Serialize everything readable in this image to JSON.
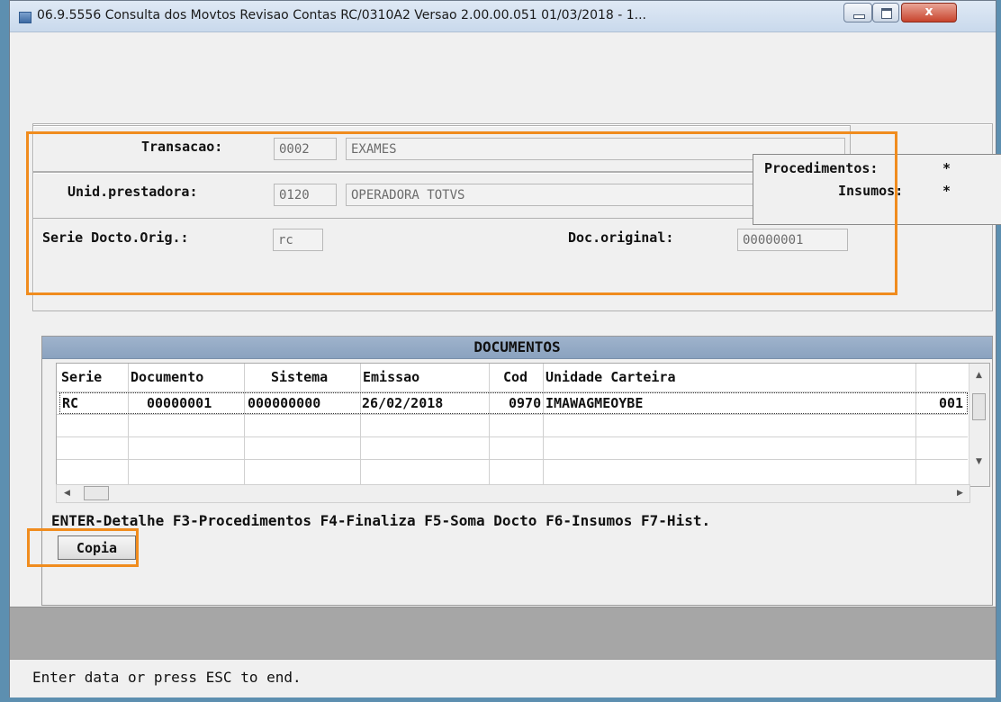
{
  "window": {
    "title": "06.9.5556 Consulta  dos Movtos Revisao Contas RC/0310A2 Versao 2.00.00.051 01/03/2018 - 1...",
    "close_glyph": "x"
  },
  "form": {
    "transacao_label": "Transacao:",
    "transacao_code": "0002",
    "transacao_desc": "EXAMES",
    "unid_label": "Unid.prestadora:",
    "unid_code": "0120",
    "unid_desc": "OPERADORA TOTVS",
    "serie_label": "Serie Docto.Orig.:",
    "serie_value": "rc",
    "doc_label": "Doc.original:",
    "doc_value": "00000001",
    "procedimentos_label": "Procedimentos:",
    "procedimentos_value": "*",
    "insumos_label": "Insumos:",
    "insumos_value": "*"
  },
  "documents": {
    "header": "DOCUMENTOS",
    "columns": [
      "Serie",
      "Documento",
      "Sistema",
      "Emissao",
      "Cod",
      "Unidade Carteira"
    ],
    "rows": [
      {
        "serie": "RC",
        "documento": "00000001",
        "sistema": "000000000",
        "emissao": "26/02/2018",
        "cod": "0970",
        "unidade": "IMAWAGMEOYBE",
        "extra": "001"
      }
    ],
    "function_keys": "ENTER-Detalhe F3-Procedimentos F4-Finaliza F5-Soma Docto F6-Insumos F7-Hist.",
    "copy_button": "Copia"
  },
  "status_bar": {
    "message": "Enter data or press ESC to end."
  },
  "colors": {
    "highlight": "#f08c1e",
    "section_header": "#8aa2bf"
  }
}
